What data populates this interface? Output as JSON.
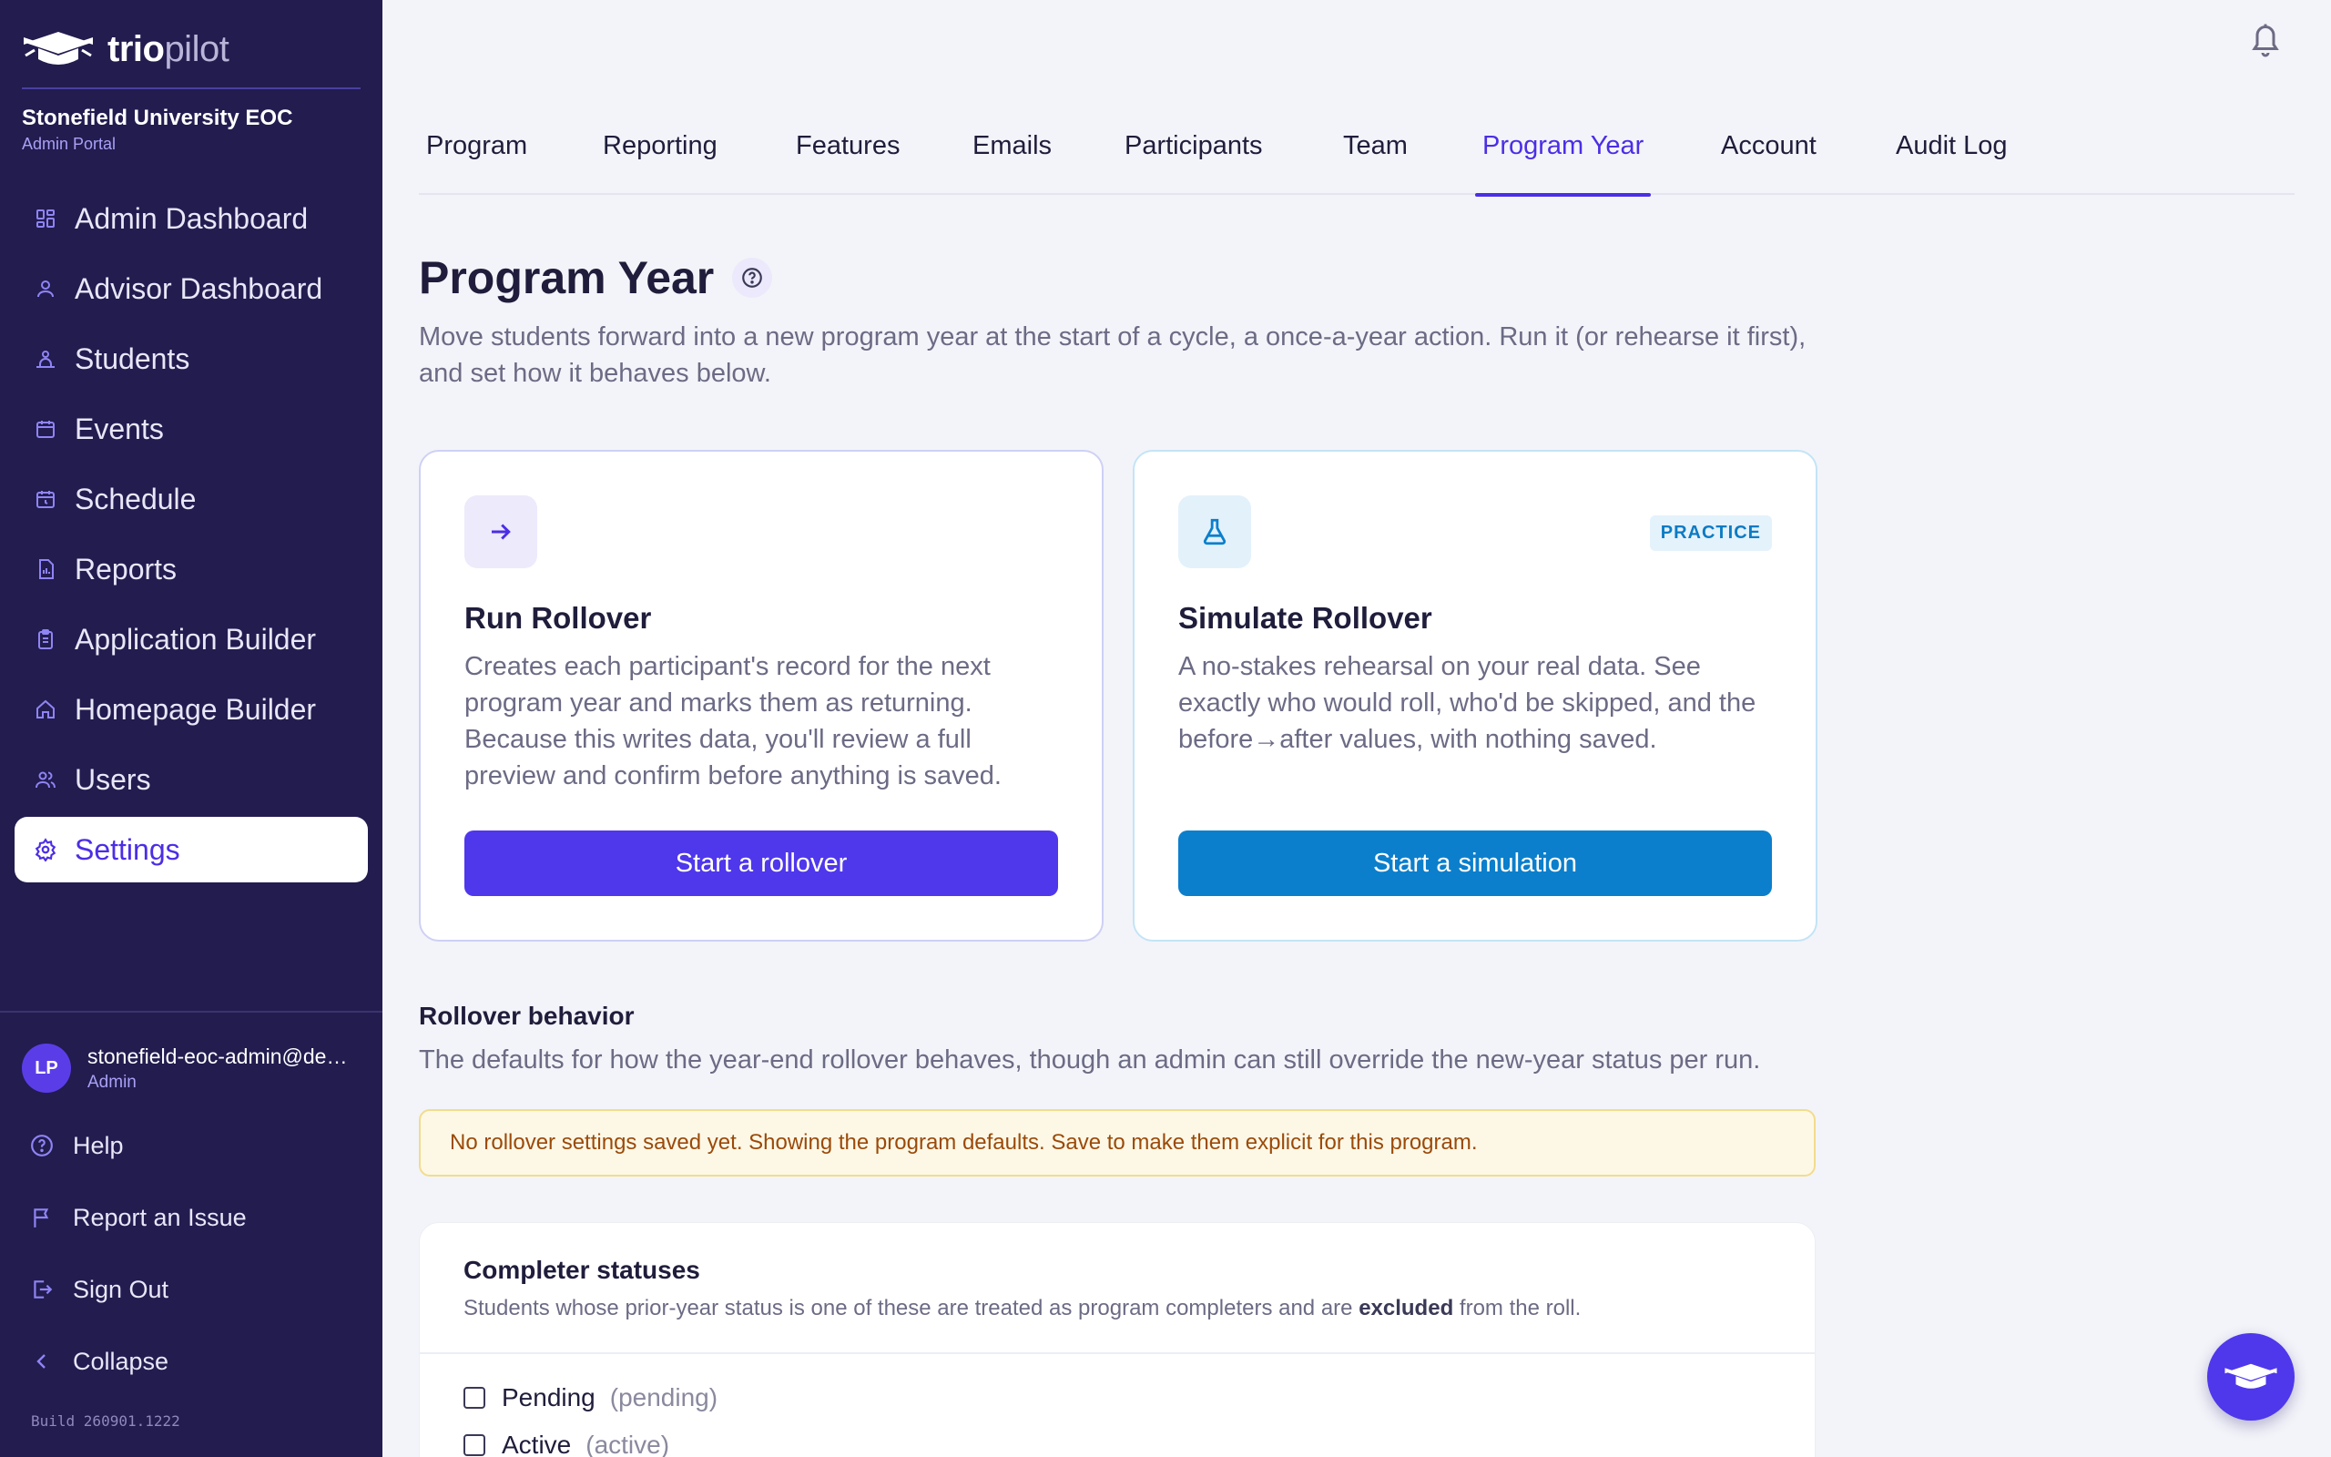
{
  "app": {
    "logo_bold": "trio",
    "logo_light": "pilot",
    "logo_icon": "graduation-cap-icon"
  },
  "org": {
    "name": "Stonefield University EOC",
    "portal": "Admin Portal"
  },
  "sidebar": {
    "items": [
      {
        "label": "Admin Dashboard",
        "icon": "dashboard-grid-icon"
      },
      {
        "label": "Advisor Dashboard",
        "icon": "user-icon"
      },
      {
        "label": "Students",
        "icon": "students-icon"
      },
      {
        "label": "Events",
        "icon": "calendar-icon"
      },
      {
        "label": "Schedule",
        "icon": "calendar-clock-icon"
      },
      {
        "label": "Reports",
        "icon": "report-chart-icon"
      },
      {
        "label": "Application Builder",
        "icon": "clipboard-icon"
      },
      {
        "label": "Homepage Builder",
        "icon": "home-icon"
      },
      {
        "label": "Users",
        "icon": "users-icon"
      },
      {
        "label": "Settings",
        "icon": "gear-icon",
        "active": true
      }
    ],
    "user": {
      "initials": "LP",
      "email": "stonefield-eoc-admin@demo.triopilot.com",
      "role": "Admin"
    },
    "footer": {
      "help": "Help",
      "report_issue": "Report an Issue",
      "sign_out": "Sign Out",
      "collapse": "Collapse"
    },
    "build": "Build 260901.1222"
  },
  "tabs": [
    "Program",
    "Reporting",
    "Features",
    "Emails",
    "Participants",
    "Team",
    "Program Year",
    "Account",
    "Audit Log"
  ],
  "active_tab": "Program Year",
  "page": {
    "title": "Program Year",
    "description": "Move students forward into a new program year at the start of a cycle, a once-a-year action. Run it (or rehearse it first), and set how it behaves below."
  },
  "cards": {
    "run": {
      "title": "Run Rollover",
      "body": "Creates each participant's record for the next program year and marks them as returning. Because this writes data, you'll review a full preview and confirm before anything is saved.",
      "button": "Start a rollover",
      "icon": "arrow-right-icon"
    },
    "simulate": {
      "title": "Simulate Rollover",
      "body": "A no-stakes rehearsal on your real data. See exactly who would roll, who'd be skipped, and the before→after values, with nothing saved.",
      "button": "Start a simulation",
      "badge": "PRACTICE",
      "icon": "flask-icon"
    }
  },
  "rollover": {
    "title": "Rollover behavior",
    "description": "The defaults for how the year-end rollover behaves, though an admin can still override the new-year status per run.",
    "notice": "No rollover settings saved yet. Showing the program defaults. Save to make them explicit for this program."
  },
  "completer": {
    "title": "Completer statuses",
    "desc_before": "Students whose prior-year status is one of these are treated as program completers and are ",
    "desc_bold": "excluded",
    "desc_after": " from the roll.",
    "options": [
      {
        "label": "Pending",
        "code": "(pending)",
        "checked": false
      },
      {
        "label": "Active",
        "code": "(active)",
        "checked": false
      }
    ]
  },
  "colors": {
    "sidebar": "#221c4f",
    "accent": "#4f37ec",
    "simulate": "#0b7fcc",
    "notice_bg": "#fdf8e6"
  }
}
